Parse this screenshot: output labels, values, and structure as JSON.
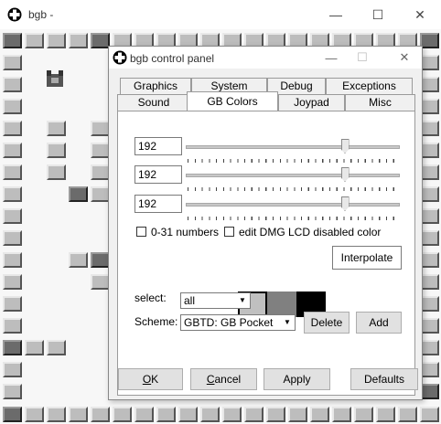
{
  "main_window": {
    "title": "bgb -",
    "icon": "bgb-app-icon",
    "controls": {
      "minimize": "—",
      "maximize": "☐",
      "close": "✕"
    }
  },
  "panel": {
    "title": "bgb control panel",
    "icon": "bgb-app-icon",
    "controls": {
      "minimize": "—",
      "maximize": "☐",
      "close": "✕"
    },
    "tabs_row1": [
      "Graphics",
      "System",
      "Debug",
      "Exceptions"
    ],
    "tabs_row2": [
      "Sound",
      "GB Colors",
      "Joypad",
      "Misc"
    ],
    "active_tab": "GB Colors",
    "gb_colors": {
      "channels": [
        {
          "value": "192",
          "level": 0.75
        },
        {
          "value": "192",
          "level": 0.75
        },
        {
          "value": "192",
          "level": 0.75
        }
      ],
      "checkbox_numbers_label": "0-31 numbers",
      "checkbox_numbers_checked": false,
      "checkbox_lcd_label": "edit DMG LCD disabled color",
      "checkbox_lcd_checked": false,
      "swatches": [
        "#ffffff",
        "#c0c0c0",
        "#808080",
        "#000000"
      ],
      "interpolate_label": "Interpolate",
      "select_label": "select:",
      "select_value": "all",
      "scheme_label": "Scheme:",
      "scheme_value": "GBTD: GB Pocket",
      "delete_label": "Delete",
      "add_label": "Add"
    },
    "buttons": {
      "ok_hot": "O",
      "ok_rest": "K",
      "cancel_hot": "C",
      "cancel_rest": "ancel",
      "apply": "Apply",
      "defaults": "Defaults"
    }
  }
}
